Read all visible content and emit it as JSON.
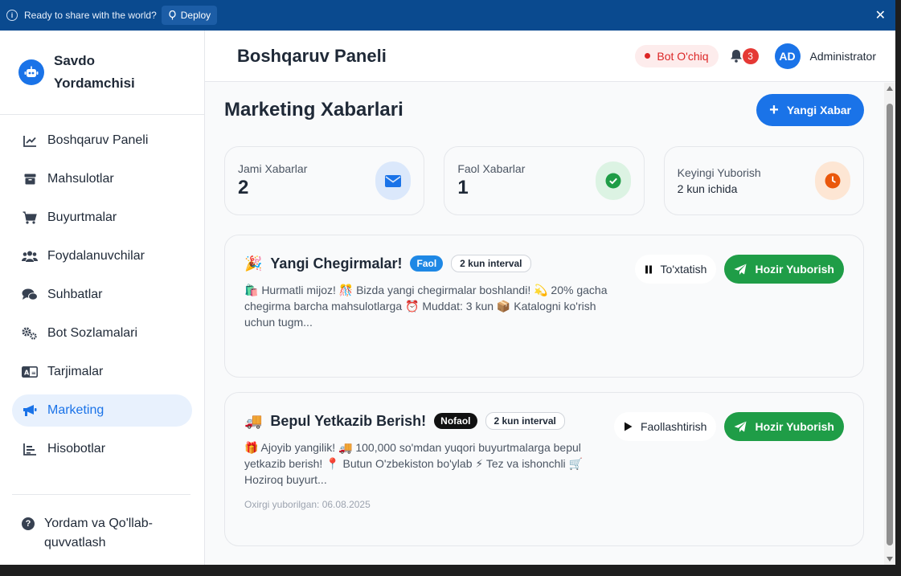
{
  "topbar": {
    "message": "Ready to share with the world?",
    "deploy_label": "Deploy"
  },
  "brand": {
    "title": "Savdo Yordamchisi"
  },
  "sidebar": {
    "items": [
      {
        "label": "Boshqaruv Paneli",
        "icon": "chart-line-icon"
      },
      {
        "label": "Mahsulotlar",
        "icon": "box-icon"
      },
      {
        "label": "Buyurtmalar",
        "icon": "cart-icon"
      },
      {
        "label": "Foydalanuvchilar",
        "icon": "users-icon"
      },
      {
        "label": "Suhbatlar",
        "icon": "chat-icon"
      },
      {
        "label": "Bot Sozlamalari",
        "icon": "gears-icon"
      },
      {
        "label": "Tarjimalar",
        "icon": "language-icon"
      },
      {
        "label": "Marketing",
        "icon": "megaphone-icon",
        "active": true
      },
      {
        "label": "Hisobotlar",
        "icon": "bar-chart-icon"
      }
    ],
    "help_label": "Yordam va Qo'llab-quvvatlash"
  },
  "header": {
    "title": "Boshqaruv Paneli",
    "bot_status": "Bot O'chiq",
    "notifications_count": "3",
    "avatar_initials": "AD",
    "user_name": "Administrator"
  },
  "page": {
    "title": "Marketing Xabarlari",
    "new_button": "Yangi Xabar"
  },
  "stats": [
    {
      "label": "Jami Xabarlar",
      "value": "2",
      "icon": "envelope-icon",
      "color": "#1a73e8"
    },
    {
      "label": "Faol Xabarlar",
      "value": "1",
      "icon": "check-circle-icon",
      "color": "#1f9d47"
    },
    {
      "label": "Keyingi Yuborish",
      "value": "2 kun ichida",
      "icon": "clock-icon",
      "color": "#ea580c"
    }
  ],
  "messages": [
    {
      "emoji": "🎉",
      "title": "Yangi Chegirmalar!",
      "status": "Faol",
      "interval": "2 kun interval",
      "body": "🛍️ Hurmatli mijoz! 🎊 Bizda yangi chegirmalar boshlandi! 💫 20% gacha chegirma barcha mahsulotlarga ⏰ Muddat: 3 kun 📦 Katalogni ko'rish uchun tugm...",
      "meta": "",
      "toggle_label": "To'xtatish",
      "send_label": "Hozir Yuborish"
    },
    {
      "emoji": "🚚",
      "title": "Bepul Yetkazib Berish!",
      "status": "Nofaol",
      "interval": "2 kun interval",
      "body": "🎁 Ajoyib yangilik! 🚚 100,000 so'mdan yuqori buyurtmalarga bepul yetkazib berish! 📍 Butun O'zbekiston bo'ylab ⚡ Tez va ishonchli 🛒 Hoziroq buyurt...",
      "meta": "Oxirgi yuborilgan: 06.08.2025",
      "toggle_label": "Faollashtirish",
      "send_label": "Hozir Yuborish"
    }
  ]
}
